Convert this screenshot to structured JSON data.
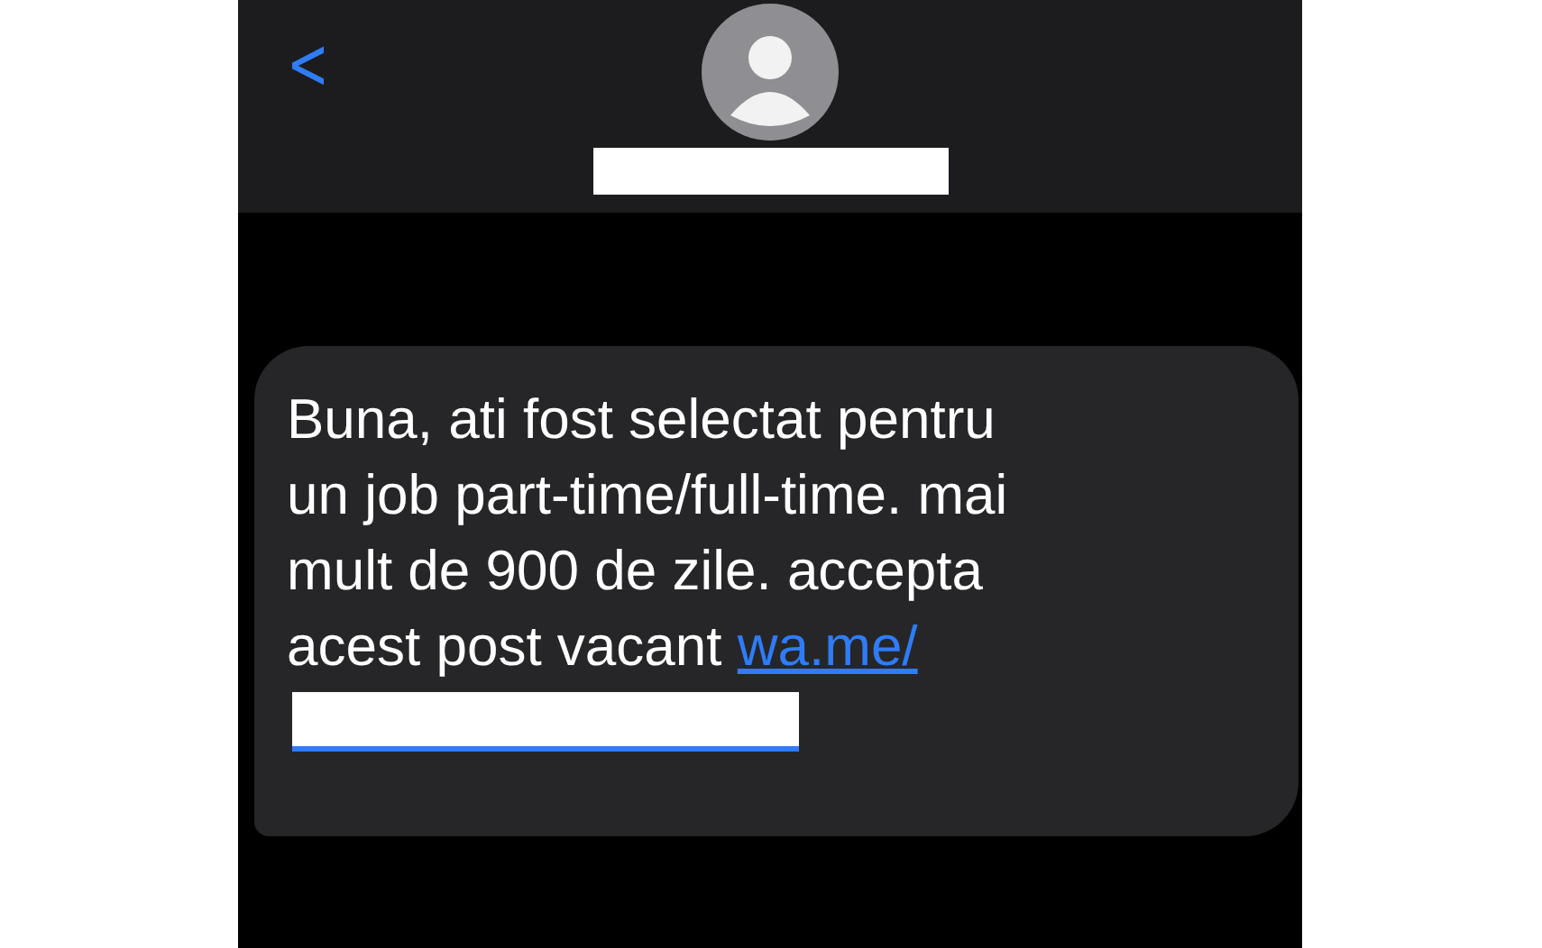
{
  "header": {
    "back": "<"
  },
  "message": {
    "lines": [
      "Buna, ati fost selectat pentru",
      "un job part-time/full-time. mai",
      "mult de 900 de zile. accepta",
      "acest post vacant"
    ],
    "link": "wa.me/"
  }
}
